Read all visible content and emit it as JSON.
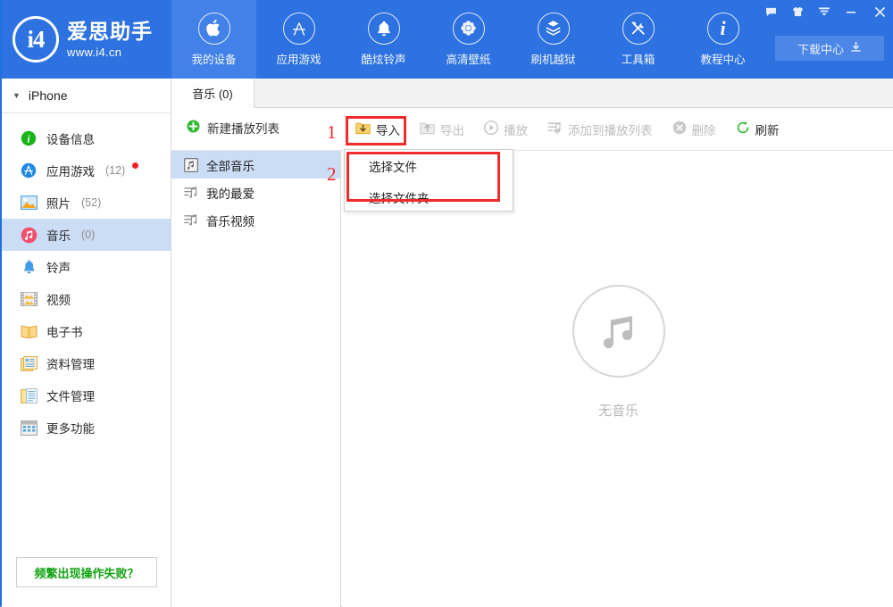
{
  "app": {
    "brand_mark": "i4",
    "brand_title": "爱思助手",
    "brand_sub": "www.i4.cn"
  },
  "topnav": {
    "items": [
      {
        "label": "我的设备",
        "icon": "apple-icon",
        "active": true
      },
      {
        "label": "应用游戏",
        "icon": "appstore-icon",
        "active": false
      },
      {
        "label": "酷炫铃声",
        "icon": "bell-icon",
        "active": false
      },
      {
        "label": "高清壁纸",
        "icon": "flower-icon",
        "active": false
      },
      {
        "label": "刷机越狱",
        "icon": "open-box-icon",
        "active": false
      },
      {
        "label": "工具箱",
        "icon": "tools-icon",
        "active": false
      },
      {
        "label": "教程中心",
        "icon": "info-icon",
        "active": false
      }
    ],
    "download_center": "下载中心",
    "window_controls": [
      {
        "name": "feedback-icon"
      },
      {
        "name": "skin-icon"
      },
      {
        "name": "menu-icon"
      },
      {
        "name": "minimize-icon"
      },
      {
        "name": "close-icon"
      }
    ]
  },
  "sidebar": {
    "device_name": "iPhone",
    "items": [
      {
        "label": "设备信息",
        "count": "",
        "icon": "info-circle-icon",
        "active": false,
        "badge": false
      },
      {
        "label": "应用游戏",
        "count": "(12)",
        "icon": "appstore-icon",
        "active": false,
        "badge": true
      },
      {
        "label": "照片",
        "count": "(52)",
        "icon": "photo-icon",
        "active": false,
        "badge": false
      },
      {
        "label": "音乐",
        "count": "(0)",
        "icon": "music-icon",
        "active": true,
        "badge": false
      },
      {
        "label": "铃声",
        "count": "",
        "icon": "bell-icon",
        "active": false,
        "badge": false
      },
      {
        "label": "视频",
        "count": "",
        "icon": "film-icon",
        "active": false,
        "badge": false
      },
      {
        "label": "电子书",
        "count": "",
        "icon": "book-icon",
        "active": false,
        "badge": false
      },
      {
        "label": "资料管理",
        "count": "",
        "icon": "data-manage-icon",
        "active": false,
        "badge": false
      },
      {
        "label": "文件管理",
        "count": "",
        "icon": "file-manage-icon",
        "active": false,
        "badge": false
      },
      {
        "label": "更多功能",
        "count": "",
        "icon": "more-features-icon",
        "active": false,
        "badge": false
      }
    ],
    "help_button": "频繁出现操作失败？"
  },
  "tabs": [
    {
      "label": "音乐 (0)",
      "active": true
    }
  ],
  "toolbar": {
    "new_playlist": "新建播放列表",
    "buttons": [
      {
        "label": "导入",
        "icon": "import-icon",
        "enabled": true
      },
      {
        "label": "导出",
        "icon": "export-icon",
        "enabled": false
      },
      {
        "label": "播放",
        "icon": "play-icon",
        "enabled": false
      },
      {
        "label": "添加到播放列表",
        "icon": "add-to-playlist-icon",
        "enabled": false
      },
      {
        "label": "删除",
        "icon": "delete-icon",
        "enabled": false
      },
      {
        "label": "刷新",
        "icon": "refresh-icon",
        "enabled": true
      }
    ]
  },
  "playlists": [
    {
      "label": "全部音乐",
      "icon": "all-music-icon",
      "active": true
    },
    {
      "label": "我的最爱",
      "icon": "playlist-icon",
      "active": false
    },
    {
      "label": "音乐视频",
      "icon": "playlist-icon",
      "active": false
    }
  ],
  "content": {
    "empty_icon": "music-note-icon",
    "empty_text": "无音乐"
  },
  "dropdown": {
    "items": [
      {
        "label": "选择文件"
      },
      {
        "label": "选择文件夹"
      }
    ]
  },
  "annotations": [
    {
      "number": "1"
    },
    {
      "number": "2"
    }
  ],
  "colors": {
    "brand_blue": "#2d72e0",
    "nav_active": "#4282e8",
    "sidebar_active": "#cbdcf5",
    "annotation_red": "#f02b2b",
    "help_green": "#12a312",
    "badge_red": "#ef2222"
  }
}
